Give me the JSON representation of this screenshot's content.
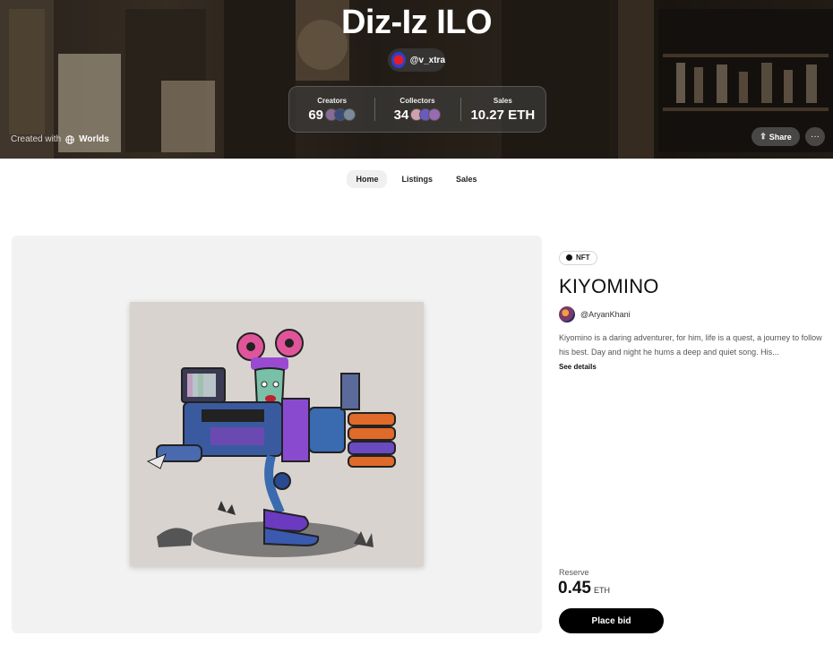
{
  "hero": {
    "title": "Diz-Iz ILO",
    "owner_handle": "@v_xtra",
    "created_with_label": "Created with",
    "created_with_brand": "Worlds",
    "share_label": "Share",
    "more_label": "···"
  },
  "stats": [
    {
      "label": "Creators",
      "value": "69"
    },
    {
      "label": "Collectors",
      "value": "34"
    },
    {
      "label": "Sales",
      "value": "10.27 ETH"
    }
  ],
  "tabs": [
    {
      "label": "Home",
      "active": true
    },
    {
      "label": "Listings",
      "active": false
    },
    {
      "label": "Sales",
      "active": false
    }
  ],
  "nft": {
    "badge": "NFT",
    "title": "KIYOMINO",
    "creator_handle": "@AryanKhani",
    "description": "Kiyomino is a daring adventurer, for him, life is a quest, a journey to follow his best. Day and night he hums a deep and quiet song. His...",
    "see_details": "See details",
    "reserve_label": "Reserve",
    "reserve_amount": "0.45",
    "reserve_unit": "ETH",
    "bid_label": "Place bid"
  },
  "colors": {
    "accent": "#000000",
    "panel_bg": "#f2f2f2",
    "art_bg": "#d9d3cf"
  }
}
